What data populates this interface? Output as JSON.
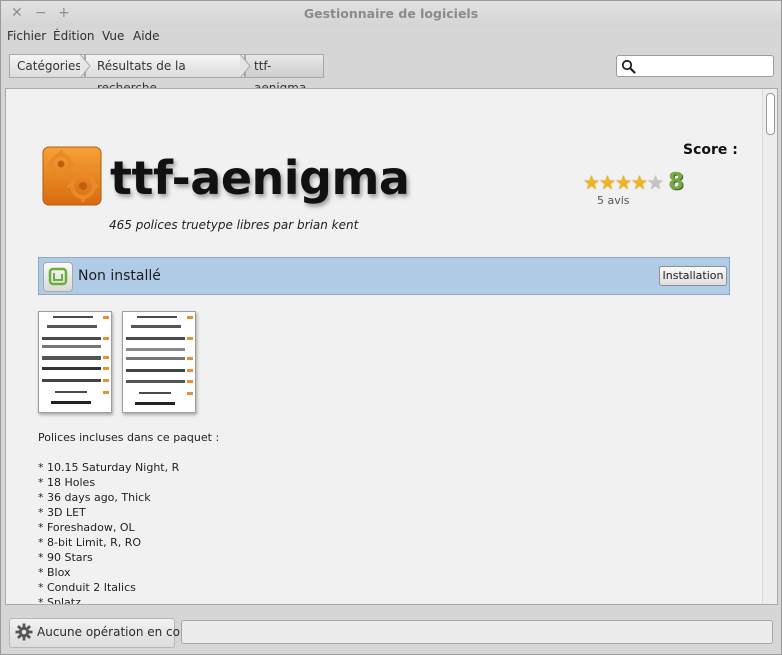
{
  "window": {
    "title": "Gestionnaire de logiciels",
    "controls": {
      "close": "✕",
      "minimize": "−",
      "maximize": "+"
    }
  },
  "menu": {
    "items": [
      "Fichier",
      "Édition",
      "Vue",
      "Aide"
    ]
  },
  "breadcrumb": {
    "items": [
      "Catégories",
      "Résultats de la recherche",
      "ttf-aenigma"
    ]
  },
  "search": {
    "value": "",
    "placeholder": ""
  },
  "package": {
    "name": "ttf-aenigma",
    "summary": "465 polices truetype libres par brian kent",
    "score_label": "Score :",
    "rating": 4,
    "rating_max": 5,
    "score_value": "8",
    "reviews": "5 avis",
    "status": "Non installé",
    "install_button": "Installation",
    "description_intro": "Polices incluses dans ce paquet :",
    "fonts": [
      "* 10.15 Saturday Night, R",
      "* 18 Holes",
      "* 36 days ago, Thick",
      "* 3D LET",
      "* Foreshadow, OL",
      "* 8-bit Limit, R, RO",
      "* 90 Stars",
      "* Blox",
      "* Conduit 2 Italics",
      "* Splatz"
    ]
  },
  "statusbar": {
    "text": "Aucune opération en cours"
  },
  "colors": {
    "accent_orange": "#e87e1a",
    "status_banner": "#b0cbe6",
    "score_green": "#77a946",
    "star_on": "#f1b51c",
    "star_off": "#c3c3c3"
  }
}
